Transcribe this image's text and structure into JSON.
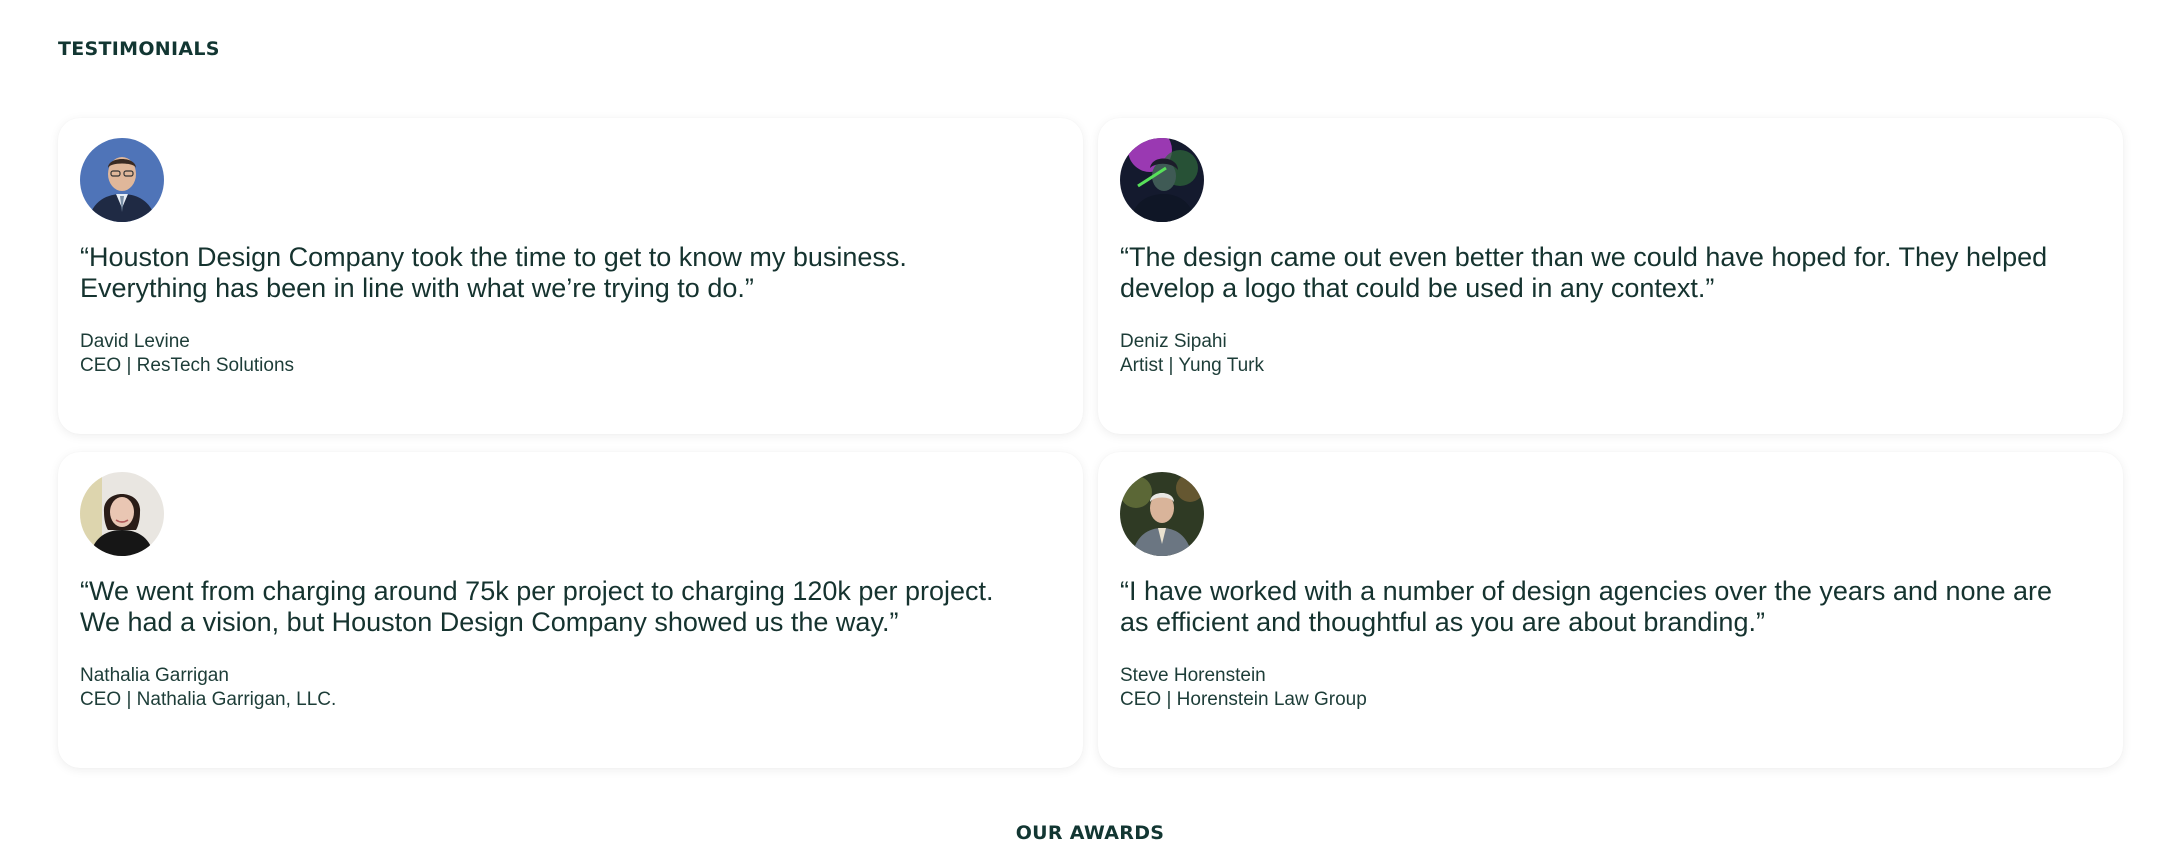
{
  "sections": {
    "testimonials_heading": "TESTIMONIALS",
    "awards_heading": "OUR AWARDS"
  },
  "testimonials": [
    {
      "quote": "“Houston Design Company took the time to get to know my business. Everything has been in line with what we’re trying to do.”",
      "name": "David Levine",
      "role": "CEO | ResTech Solutions",
      "avatar_icon": "person-portrait-icon"
    },
    {
      "quote": "“The design came out even better than we could have hoped for. They helped develop a logo that could be used in any context.”",
      "name": "Deniz Sipahi",
      "role": "Artist | Yung Turk",
      "avatar_icon": "person-portrait-icon"
    },
    {
      "quote": "“We went from charging around 75k per project to charging 120k per project. We had a vision, but Houston Design Company showed us the way.”",
      "name": "Nathalia Garrigan",
      "role": "CEO | Nathalia Garrigan, LLC.",
      "avatar_icon": "person-portrait-icon"
    },
    {
      "quote": "“I have worked with a number of design agencies over the years and none are as efficient and thoughtful as you are about branding.”",
      "name": "Steve Horenstein",
      "role": "CEO | Horenstein Law Group",
      "avatar_icon": "person-portrait-icon"
    }
  ],
  "colors": {
    "heading": "#123632",
    "text": "#15332f",
    "card_background": "#ffffff",
    "page_background": "#ffffff"
  }
}
